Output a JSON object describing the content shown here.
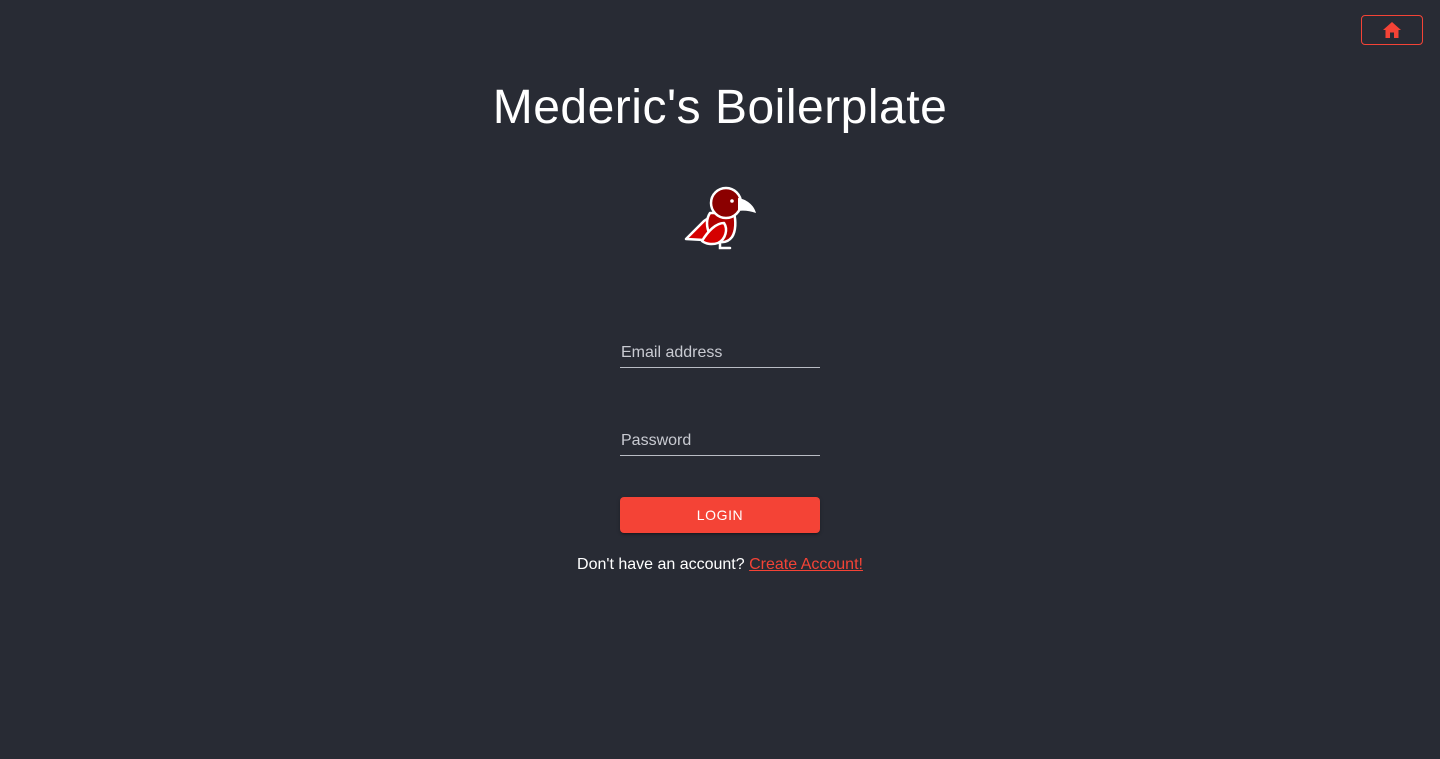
{
  "header": {
    "home_button_icon": "home-icon",
    "title": "Mederic's Boilerplate"
  },
  "logo": {
    "icon": "bird-logo-icon"
  },
  "form": {
    "email_label": "Email address",
    "email_value": "",
    "password_label": "Password",
    "password_value": "",
    "login_label": "LOGIN"
  },
  "footer": {
    "prompt": "Don't have an account?",
    "link_label": "Create Account!"
  },
  "colors": {
    "background": "#282b34",
    "accent": "#f44336",
    "logo_dark_red": "#8b0000",
    "logo_red": "#d50000"
  }
}
